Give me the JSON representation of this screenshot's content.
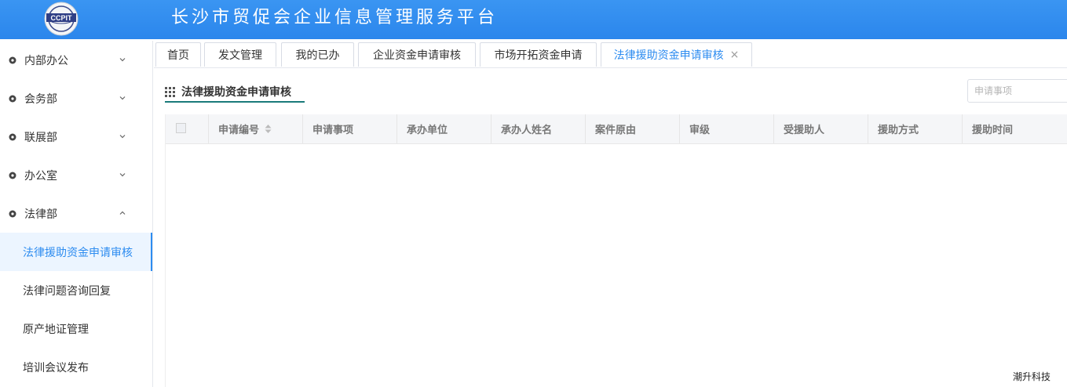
{
  "header": {
    "title": "长沙市贸促会企业信息管理服务平台",
    "logo_text": "CCPIT",
    "color": "#2d8cf0"
  },
  "sidebar": {
    "groups": [
      {
        "label": "内部办公",
        "expanded": false
      },
      {
        "label": "会务部",
        "expanded": false
      },
      {
        "label": "联展部",
        "expanded": false
      },
      {
        "label": "办公室",
        "expanded": false
      },
      {
        "label": "法律部",
        "expanded": true
      }
    ],
    "sub_items": [
      {
        "label": "法律援助资金申请审核",
        "active": true
      },
      {
        "label": "法律问题咨询回复",
        "active": false
      },
      {
        "label": "原产地证管理",
        "active": false
      },
      {
        "label": "培训会议发布",
        "active": false
      }
    ]
  },
  "tabs": [
    {
      "label": "首页"
    },
    {
      "label": "发文管理"
    },
    {
      "label": "我的已办"
    },
    {
      "label": "企业资金申请审核"
    },
    {
      "label": "市场开拓资金申请"
    },
    {
      "label": "法律援助资金申请审核",
      "active": true,
      "close": "×"
    }
  ],
  "section": {
    "title": "法律援助资金申请审核",
    "search_placeholder": "申请事项"
  },
  "table": {
    "columns": [
      "申请编号",
      "申请事项",
      "承办单位",
      "承办人姓名",
      "案件原由",
      "审级",
      "受援助人",
      "援助方式",
      "援助时间"
    ]
  },
  "footer": {
    "brand": "潮升科技"
  }
}
